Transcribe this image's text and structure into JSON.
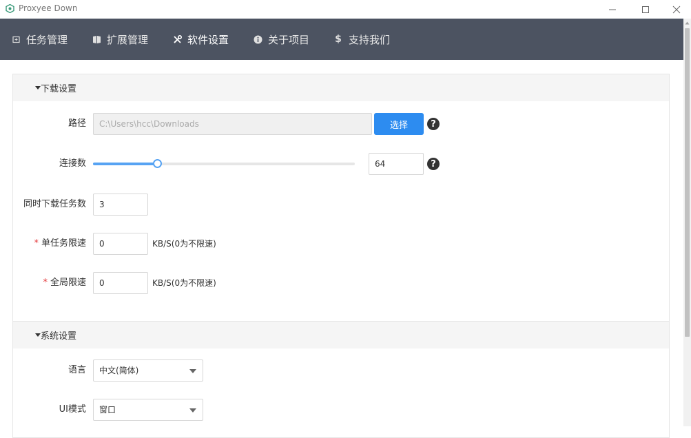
{
  "window": {
    "title": "Proxyee Down"
  },
  "nav": {
    "items": [
      {
        "label": "任务管理",
        "icon": "download-task-icon"
      },
      {
        "label": "扩展管理",
        "icon": "puzzle-extension-icon"
      },
      {
        "label": "软件设置",
        "icon": "tools-settings-icon"
      },
      {
        "label": "关于项目",
        "icon": "info-icon"
      },
      {
        "label": "支持我们",
        "icon": "dollar-icon"
      }
    ],
    "active_index": 2
  },
  "download_settings": {
    "title": "下载设置",
    "path": {
      "label": "路径",
      "value": "C:\\Users\\hcc\\Downloads",
      "choose_label": "选择"
    },
    "connections": {
      "label": "连接数",
      "value": "64",
      "slider_fraction": 0.245
    },
    "concurrent_tasks": {
      "label": "同时下载任务数",
      "value": "3"
    },
    "task_speed_limit": {
      "label": "单任务限速",
      "value": "0",
      "unit": "KB/S(0为不限速)"
    },
    "global_speed_limit": {
      "label": "全局限速",
      "value": "0",
      "unit": "KB/S(0为不限速)"
    }
  },
  "system_settings": {
    "title": "系统设置",
    "language": {
      "label": "语言",
      "value": "中文(简体)"
    },
    "ui_mode": {
      "label": "UI模式",
      "value": "窗口"
    }
  },
  "colors": {
    "navbar": "#4c5361",
    "primary": "#2d8cf0",
    "slider": "#57a3f3",
    "required": "#e4393c"
  }
}
